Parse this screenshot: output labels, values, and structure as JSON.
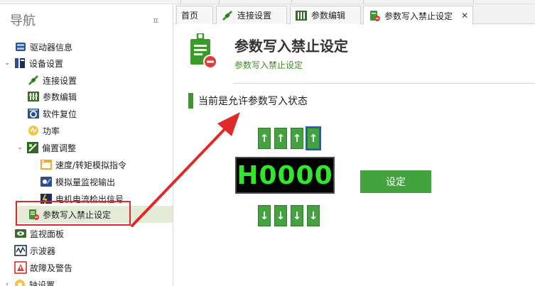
{
  "sidebar": {
    "title": "导航",
    "pin_glyph": "ㅍ",
    "items": [
      {
        "label": "驱动器信息",
        "icon": "drive-icon"
      },
      {
        "label": "设备设置",
        "icon": "device-settings-icon",
        "caret": "⌄"
      },
      {
        "label": "连接设置",
        "icon": "connection-icon"
      },
      {
        "label": "参数编辑",
        "icon": "param-edit-icon"
      },
      {
        "label": "软件复位",
        "icon": "software-reset-icon"
      },
      {
        "label": "功率",
        "icon": "power-icon"
      },
      {
        "label": "偏置调整",
        "icon": "offset-adjust-icon",
        "caret": "⌄"
      },
      {
        "label": "速度/转矩模拟指令",
        "icon": "speed-torque-icon"
      },
      {
        "label": "模拟量监视输出",
        "icon": "analog-monitor-icon"
      },
      {
        "label": "电机电流检出信号",
        "icon": "motor-current-icon"
      },
      {
        "label": "参数写入禁止设定",
        "icon": "param-write-lock-icon"
      },
      {
        "label": "监视面板",
        "icon": "monitor-panel-icon"
      },
      {
        "label": "示波器",
        "icon": "oscilloscope-icon"
      },
      {
        "label": "故障及警告",
        "icon": "fault-warning-icon"
      },
      {
        "label": "轴设置",
        "icon": "axis-settings-icon"
      }
    ]
  },
  "tabs": [
    {
      "label": "首页"
    },
    {
      "label": "连接设置"
    },
    {
      "label": "参数编辑"
    },
    {
      "label": "参数写入禁止设定",
      "close": "✕"
    }
  ],
  "content": {
    "title": "参数写入禁止设定",
    "subtitle": "参数写入禁止设定",
    "status": "当前是允许参数写入状态",
    "up_glyph": "↑",
    "down_glyph": "↓",
    "display_value": "H0000",
    "set_button": "设定"
  },
  "colors": {
    "accent_green": "#44a340",
    "display_text": "#2ee829",
    "annotation_red": "#e02a2a"
  }
}
